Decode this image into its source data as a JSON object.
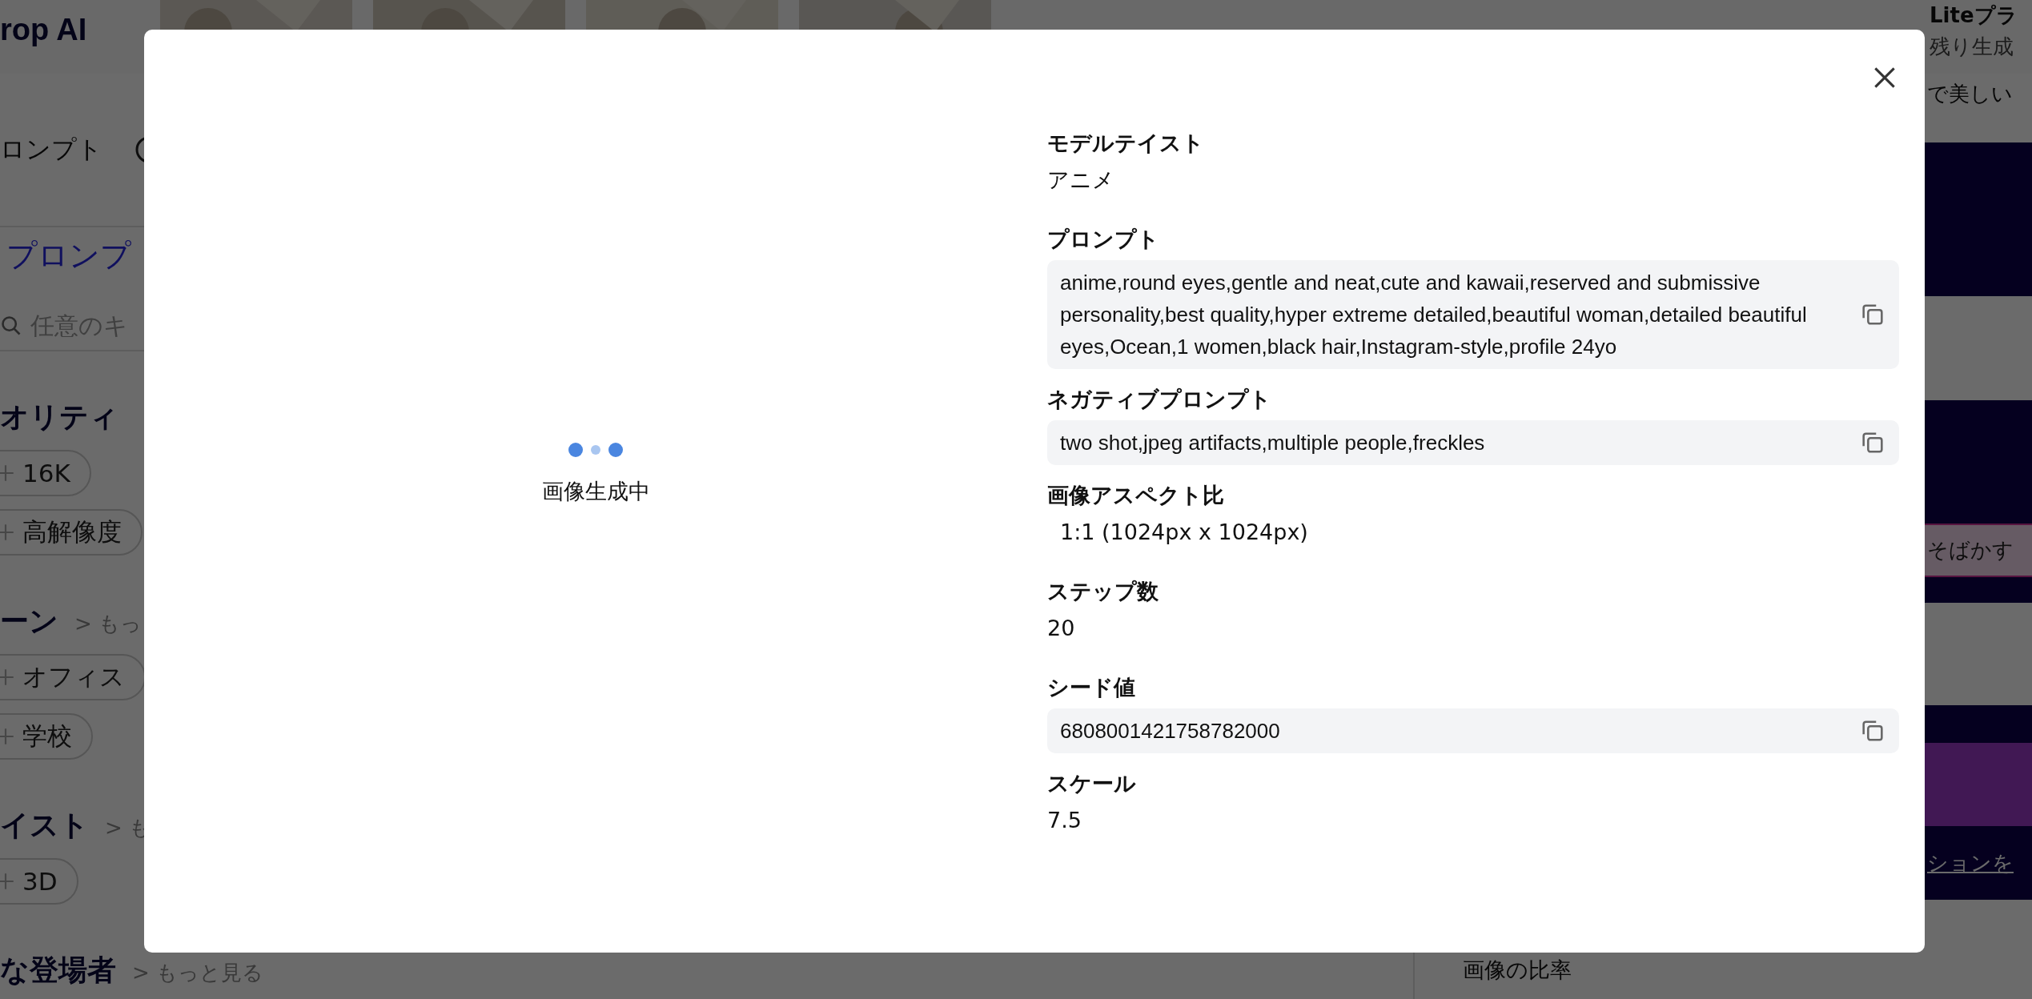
{
  "header": {
    "logo": "rop AI",
    "plan_title": "Liteプラ",
    "plan_sub": "残り生成"
  },
  "sidebar": {
    "tab": "ロンプト",
    "heading": "プロンプ",
    "search_placeholder": "任意のキ",
    "sections": [
      {
        "title": "オリティ",
        "rows": [
          [
            {
              "label": "16K",
              "selected": false
            }
          ],
          [
            {
              "label": "高解像度",
              "selected": false
            }
          ]
        ]
      },
      {
        "title": "ーン",
        "more": "> もっ",
        "rows": [
          [
            {
              "label": "オフィス",
              "selected": false
            }
          ],
          [
            {
              "label": "学校",
              "selected": false
            }
          ]
        ]
      },
      {
        "title": "イスト",
        "more": "> も",
        "rows": [
          [
            {
              "label": "3D",
              "selected": false
            }
          ]
        ]
      },
      {
        "title": "な登場者",
        "more": "> もっと見る"
      }
    ]
  },
  "panel": {
    "intro": "で美しい",
    "tag": "そばかす",
    "link": "ションを",
    "ratio_label": "画像の比率"
  },
  "modal": {
    "status": "画像生成中",
    "fields": [
      {
        "label": "モデルテイスト",
        "value": "アニメ",
        "kind": "text"
      },
      {
        "label": "プロンプト",
        "value": "anime,round eyes,gentle and neat,cute and kawaii,reserved and submissive personality,best quality,hyper extreme detailed,beautiful woman,detailed beautiful eyes,Ocean,1 women,black hair,Instagram-style,profile 24yo",
        "kind": "box"
      },
      {
        "label": "ネガティブプロンプト",
        "value": "two shot,jpeg artifacts,multiple people,freckles",
        "kind": "box"
      },
      {
        "label": "画像アスペクト比",
        "value": "1:1 (1024px x 1024px)",
        "kind": "option"
      },
      {
        "label": "ステップ数",
        "value": "20",
        "kind": "text"
      },
      {
        "label": "シード値",
        "value": "6808001421758782000",
        "kind": "box"
      },
      {
        "label": "スケール",
        "value": "7.5",
        "kind": "text"
      }
    ]
  }
}
